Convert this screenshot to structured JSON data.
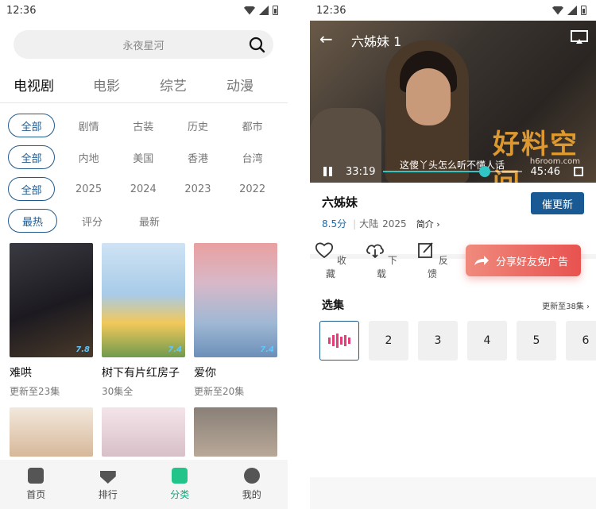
{
  "left": {
    "status": {
      "time": "12:36"
    },
    "search": {
      "placeholder": "永夜星河"
    },
    "tabs": [
      {
        "label": "电视剧",
        "active": true
      },
      {
        "label": "电影",
        "active": false
      },
      {
        "label": "综艺",
        "active": false
      },
      {
        "label": "动漫",
        "active": false
      }
    ],
    "filters": [
      {
        "selected": "全部",
        "options": [
          "剧情",
          "古装",
          "历史",
          "都市"
        ]
      },
      {
        "selected": "全部",
        "options": [
          "内地",
          "美国",
          "香港",
          "台湾"
        ]
      },
      {
        "selected": "全部",
        "options": [
          "2025",
          "2024",
          "2023",
          "2022"
        ]
      },
      {
        "selected": "最热",
        "options": [
          "评分",
          "最新"
        ]
      }
    ],
    "cards": [
      {
        "title": "难哄",
        "sub": "更新至23集",
        "score": "7.8",
        "color": "#2b2a2e"
      },
      {
        "title": "树下有片红房子",
        "sub": "30集全",
        "score": "7.4",
        "color": "#a9c9e8"
      },
      {
        "title": "爱你",
        "sub": "更新至20集",
        "score": "7.4",
        "color": "#8fb0d0"
      }
    ],
    "nav": [
      {
        "label": "首页",
        "active": false,
        "icon": "home-icon"
      },
      {
        "label": "排行",
        "active": false,
        "icon": "rank-icon"
      },
      {
        "label": "分类",
        "active": true,
        "icon": "category-icon"
      },
      {
        "label": "我的",
        "active": false,
        "icon": "profile-icon"
      }
    ]
  },
  "right": {
    "status": {
      "time": "12:36"
    },
    "player": {
      "title": "六姊妹 1",
      "subtitle": "这傻丫头怎么听不懂人话",
      "current": "33:19",
      "duration": "45:46",
      "progress": 0.73,
      "watermark": "好料空间",
      "watermark_url": "h6room.com"
    },
    "show": {
      "title": "六姊妹",
      "rating": "8.5分",
      "region": "大陆",
      "year": "2025",
      "intro": "简介 ›",
      "update_button": "催更新"
    },
    "actions": [
      {
        "label": "收藏",
        "icon": "heart-icon"
      },
      {
        "label": "下载",
        "icon": "download-icon"
      },
      {
        "label": "反馈",
        "icon": "feedback-icon"
      }
    ],
    "share": "分享好友免广告",
    "episodes": {
      "label": "选集",
      "update": "更新至38集 ›",
      "items": [
        "2",
        "3",
        "4",
        "5",
        "6"
      ]
    }
  },
  "colors": {
    "accent": "#1e5a8e",
    "green": "#23c48a",
    "share": "#e8524f"
  }
}
